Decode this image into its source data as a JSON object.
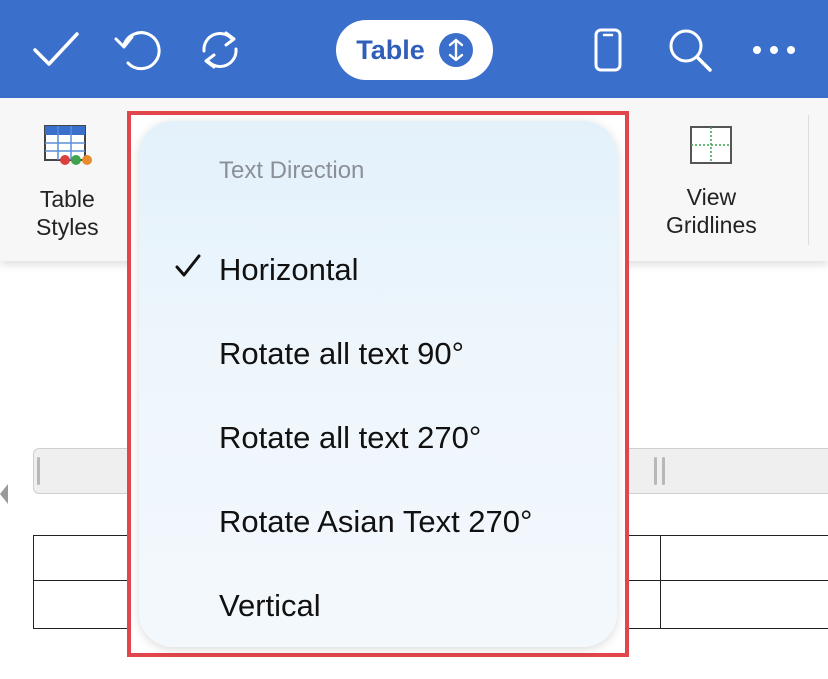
{
  "toolbar": {
    "mode_label": "Table",
    "icons": [
      "checkmark-icon",
      "undo-icon",
      "redo-icon",
      "mode-switch-icon",
      "phone-view-icon",
      "search-icon",
      "more-icon"
    ],
    "accent": "#3a6fcc"
  },
  "ribbon": {
    "table_styles_line1": "Table",
    "table_styles_line2": "Styles",
    "view_gridlines_line1": "View",
    "view_gridlines_line2": "Gridlines"
  },
  "menu": {
    "header": "Text Direction",
    "items": [
      {
        "label": "Horizontal",
        "checked": true
      },
      {
        "label": "Rotate all text 90°",
        "checked": false
      },
      {
        "label": "Rotate all text 270°",
        "checked": false
      },
      {
        "label": "Rotate Asian Text 270°",
        "checked": false
      },
      {
        "label": "Vertical",
        "checked": false
      }
    ],
    "highlight_color": "#e0464c"
  }
}
